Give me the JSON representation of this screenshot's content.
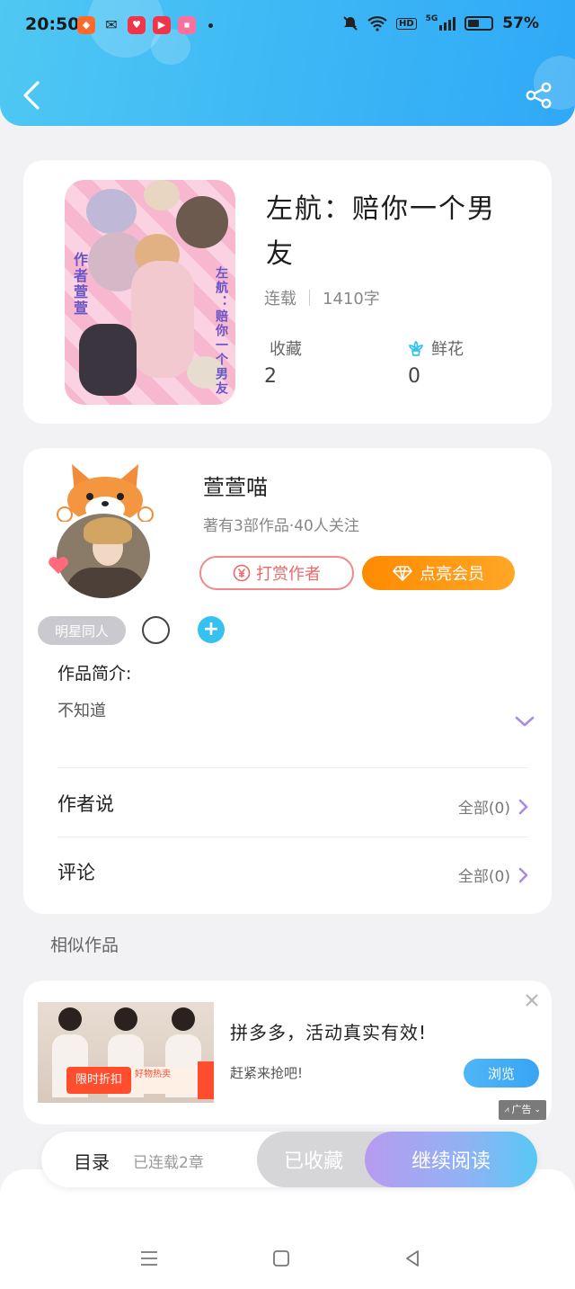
{
  "status_bar": {
    "time": "20:50",
    "battery_text": "57%",
    "battery_level": 0.57,
    "network_label": "HD",
    "signal_label": "5G"
  },
  "book": {
    "title": "左航：赔你一个男友",
    "status": "连载",
    "word_count": "1410字",
    "favorites_label": "收藏",
    "favorites_count": "2",
    "flowers_label": "鲜花",
    "flowers_count": "0",
    "cover_text_left": "作者萱萱",
    "cover_text_right": "左航：赔你一个男友"
  },
  "author": {
    "name": "萱萱喵",
    "summary": "著有3部作品·40人关注",
    "reward_label": "打赏作者",
    "vip_label": "点亮会员"
  },
  "tags": {
    "tag1": "明星同人",
    "add_symbol": "+"
  },
  "intro": {
    "label": "作品简介:",
    "text": "不知道"
  },
  "sections": {
    "author_says_label": "作者说",
    "author_says_count": "全部(0)",
    "comments_label": "评论",
    "comments_count": "全部(0)"
  },
  "similar": {
    "title": "相似作品"
  },
  "ad": {
    "title": "拼多多，活动真实有效!",
    "subtitle": "赶紧来抢吧!",
    "button": "浏览",
    "badge": "广告",
    "sale_tag": "限时折扣",
    "sale_tag2": "好物热卖"
  },
  "bottom_bar": {
    "toc_label": "目录",
    "toc_sub": "已连载2章",
    "collected_label": "已收藏",
    "continue_label": "继续阅读"
  },
  "colors": {
    "accent_blue": "#36c2ee",
    "vip_orange": "#ff8a00",
    "reward_red": "#ea6a6a"
  }
}
